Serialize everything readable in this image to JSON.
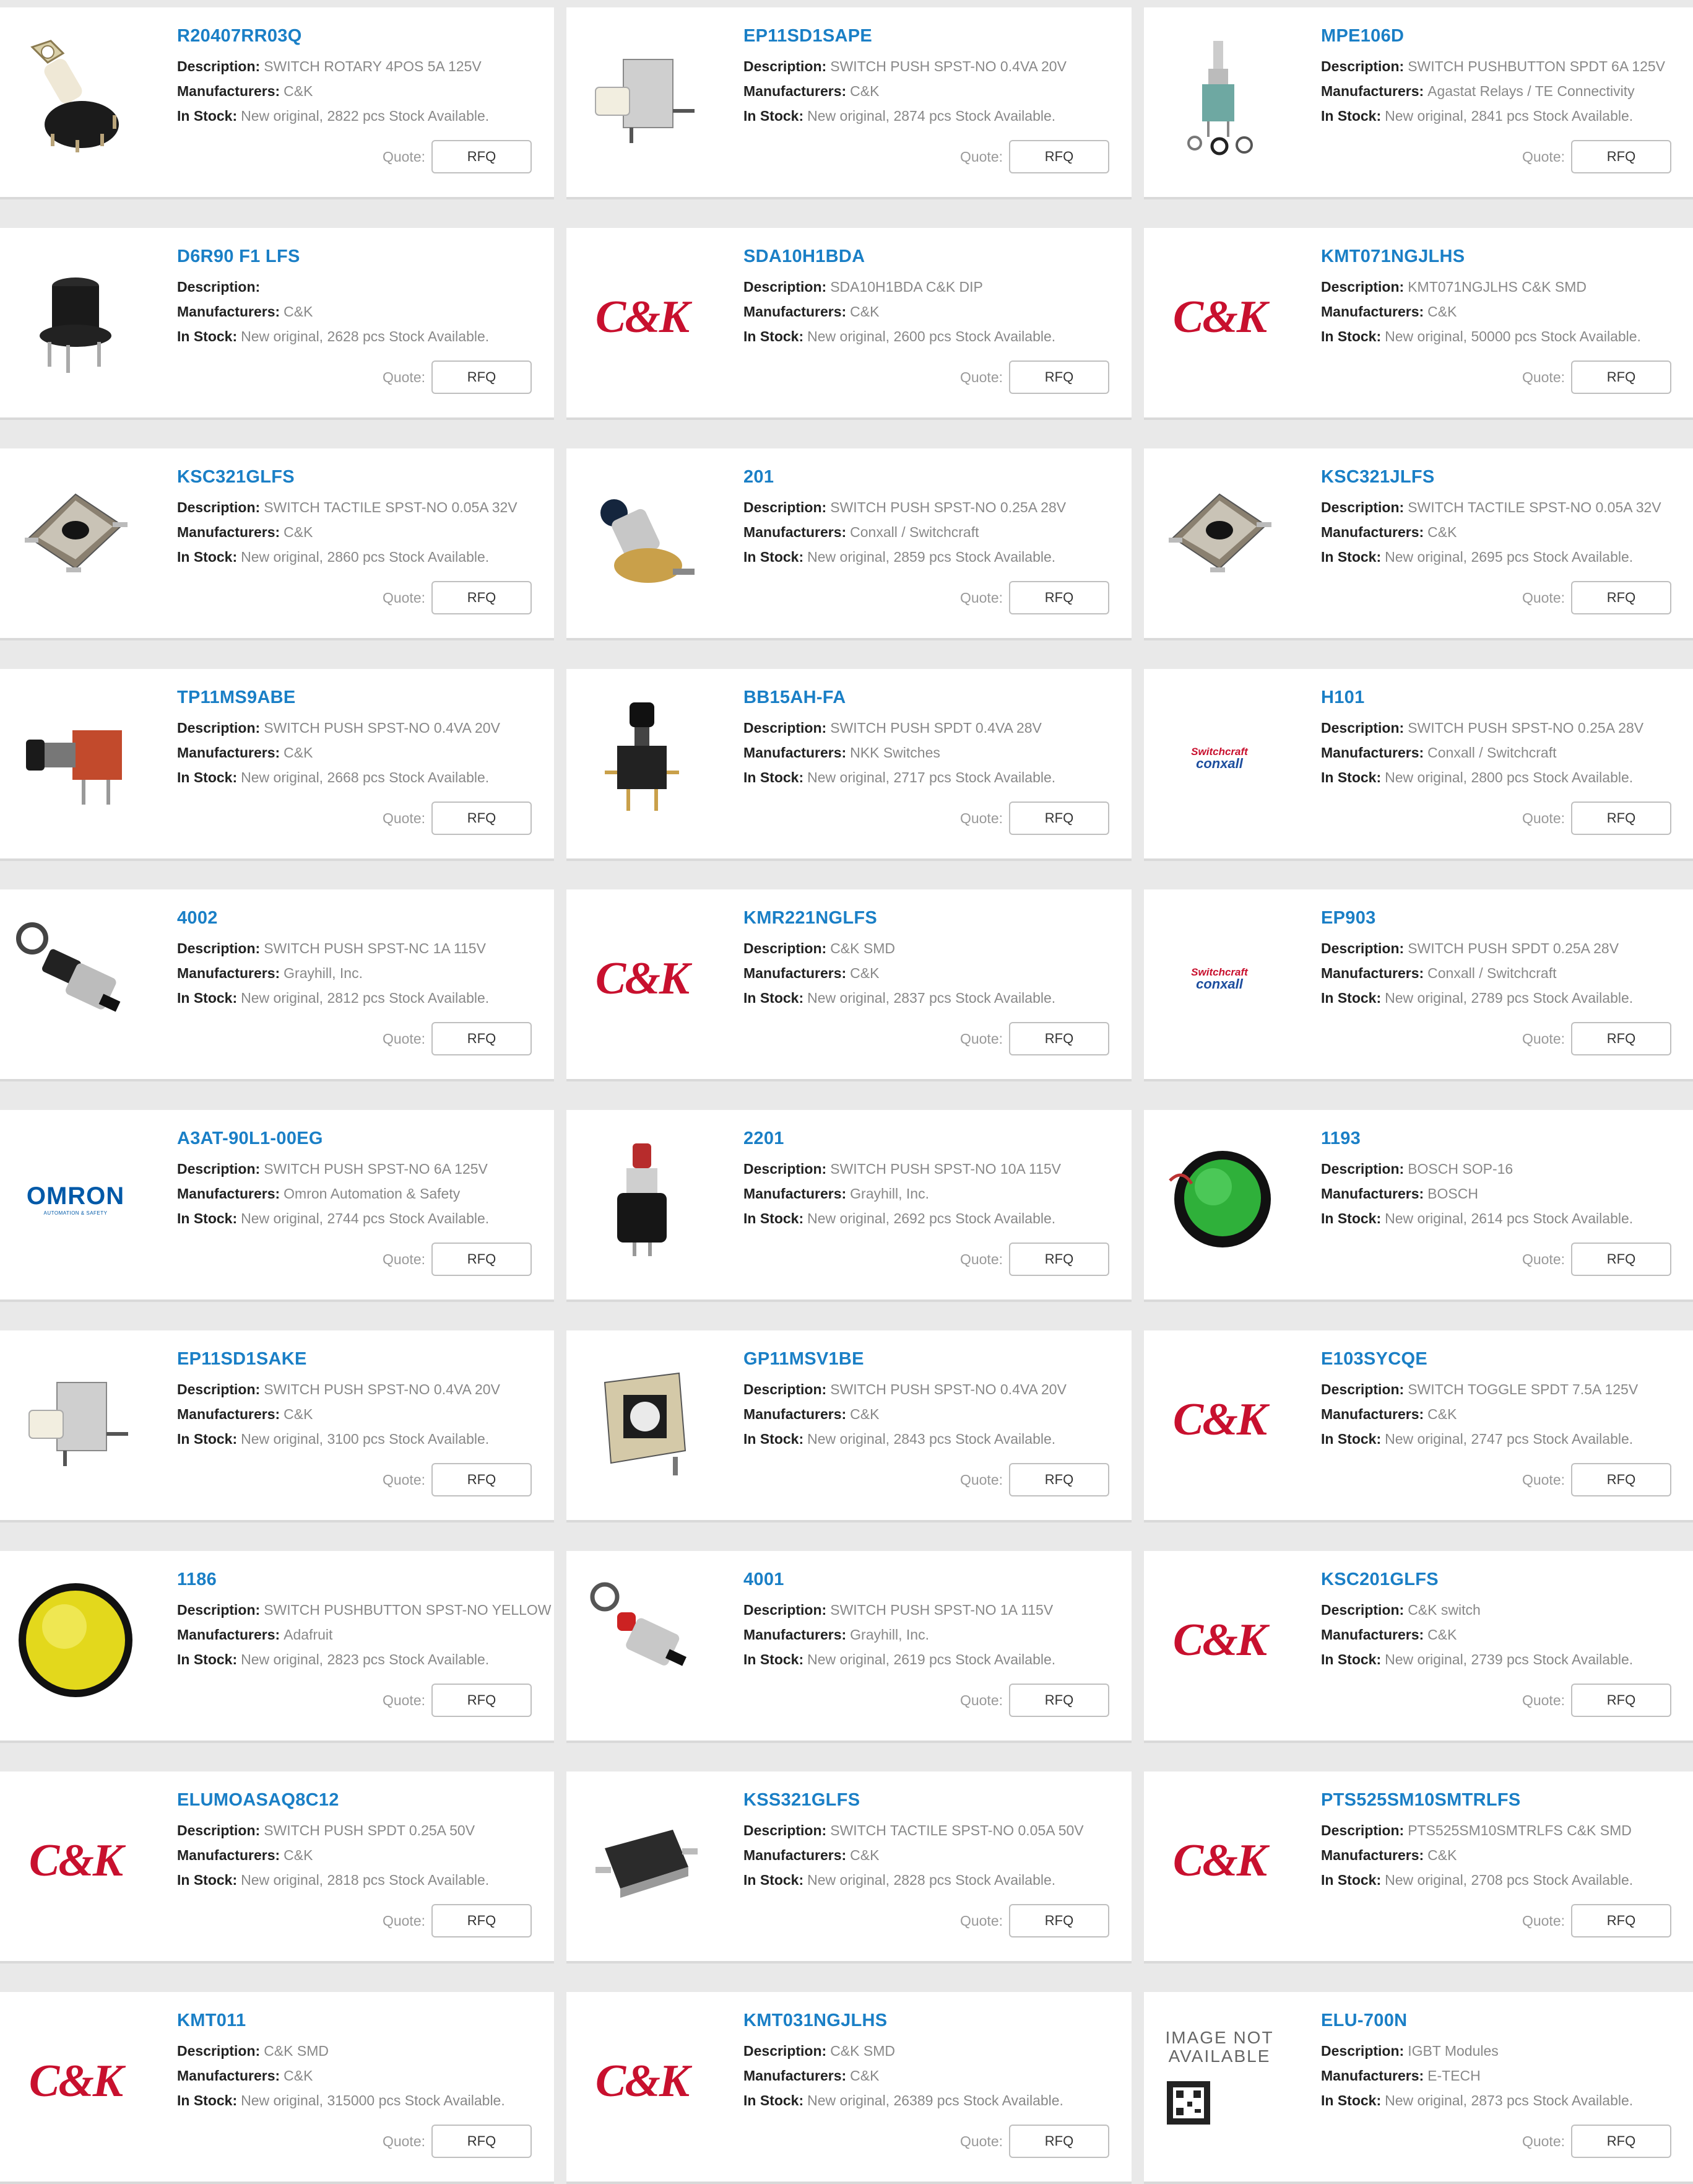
{
  "labels": {
    "description": "Description:",
    "manufacturers": "Manufacturers:",
    "in_stock": "In Stock:",
    "quote": "Quote:",
    "rfq": "RFQ"
  },
  "brands": {
    "ck": "C&K",
    "omron_word": "OMRON",
    "omron_sub": "AUTOMATION & SAFETY",
    "switchcraft": "Switchcraft",
    "conxall": "conxall",
    "image_not_available": "IMAGE NOT AVAILABLE"
  },
  "products": [
    {
      "pn": "R20407RR03Q",
      "desc": "SWITCH ROTARY 4POS 5A 125V",
      "mfr": "C&K",
      "stock": "New original, 2822 pcs Stock Available.",
      "img": "rotary-switch-image"
    },
    {
      "pn": "EP11SD1SAPE",
      "desc": "SWITCH PUSH SPST-NO 0.4VA 20V",
      "mfr": "C&K",
      "stock": "New original, 2874 pcs Stock Available.",
      "img": "push-switch-image"
    },
    {
      "pn": "MPE106D",
      "desc": "SWITCH PUSHBUTTON SPDT 6A 125V",
      "mfr": "Agastat Relays / TE Connectivity",
      "stock": "New original, 2841 pcs Stock Available.",
      "img": "pushbutton-switch-image"
    },
    {
      "pn": "D6R90 F1 LFS",
      "desc": "",
      "mfr": "C&K",
      "stock": "New original, 2628 pcs Stock Available.",
      "img": "black-round-switch-image"
    },
    {
      "pn": "SDA10H1BDA",
      "desc": "SDA10H1BDA C&K DIP",
      "mfr": "C&K",
      "stock": "New original, 2600 pcs Stock Available.",
      "img": "ck-logo"
    },
    {
      "pn": "KMT071NGJLHS",
      "desc": "KMT071NGJLHS C&K SMD",
      "mfr": "C&K",
      "stock": "New original, 50000 pcs Stock Available.",
      "img": "ck-logo"
    },
    {
      "pn": "KSC321GLFS",
      "desc": "SWITCH TACTILE SPST-NO 0.05A 32V",
      "mfr": "C&K",
      "stock": "New original, 2860 pcs Stock Available.",
      "img": "tactile-switch-image"
    },
    {
      "pn": "201",
      "desc": "SWITCH PUSH SPST-NO 0.25A 28V",
      "mfr": "Conxall / Switchcraft",
      "stock": "New original, 2859 pcs Stock Available.",
      "img": "panel-push-switch-image"
    },
    {
      "pn": "KSC321JLFS",
      "desc": "SWITCH TACTILE SPST-NO 0.05A 32V",
      "mfr": "C&K",
      "stock": "New original, 2695 pcs Stock Available.",
      "img": "tactile-switch-image"
    },
    {
      "pn": "TP11MS9ABE",
      "desc": "SWITCH PUSH SPST-NO 0.4VA 20V",
      "mfr": "C&K",
      "stock": "New original, 2668 pcs Stock Available.",
      "img": "red-push-switch-image"
    },
    {
      "pn": "BB15AH-FA",
      "desc": "SWITCH PUSH SPDT 0.4VA 28V",
      "mfr": "NKK Switches",
      "stock": "New original, 2717 pcs Stock Available.",
      "img": "pcb-push-switch-image"
    },
    {
      "pn": "H101",
      "desc": "SWITCH PUSH SPST-NO 0.25A 28V",
      "mfr": "Conxall / Switchcraft",
      "stock": "New original, 2800 pcs Stock Available.",
      "img": "switchcraft-logo"
    },
    {
      "pn": "4002",
      "desc": "SWITCH PUSH SPST-NC 1A 115V",
      "mfr": "Grayhill, Inc.",
      "stock": "New original, 2812 pcs Stock Available.",
      "img": "panel-mount-switch-image"
    },
    {
      "pn": "KMR221NGLFS",
      "desc": "C&K SMD",
      "mfr": "C&K",
      "stock": "New original, 2837 pcs Stock Available.",
      "img": "ck-logo"
    },
    {
      "pn": "EP903",
      "desc": "SWITCH PUSH SPDT 0.25A 28V",
      "mfr": "Conxall / Switchcraft",
      "stock": "New original, 2789 pcs Stock Available.",
      "img": "switchcraft-logo"
    },
    {
      "pn": "A3AT-90L1-00EG",
      "desc": "SWITCH PUSH SPST-NO 6A 125V",
      "mfr": "Omron Automation & Safety",
      "stock": "New original, 2744 pcs Stock Available.",
      "img": "omron-logo"
    },
    {
      "pn": "2201",
      "desc": "SWITCH PUSH SPST-NO 10A 115V",
      "mfr": "Grayhill, Inc.",
      "stock": "New original, 2692 pcs Stock Available.",
      "img": "red-cap-switch-image"
    },
    {
      "pn": "1193",
      "desc": "BOSCH SOP-16",
      "mfr": "BOSCH",
      "stock": "New original, 2614 pcs Stock Available.",
      "img": "green-button-image"
    },
    {
      "pn": "EP11SD1SAKE",
      "desc": "SWITCH PUSH SPST-NO 0.4VA 20V",
      "mfr": "C&K",
      "stock": "New original, 3100 pcs Stock Available.",
      "img": "push-switch-image"
    },
    {
      "pn": "GP11MSV1BE",
      "desc": "SWITCH PUSH SPST-NO 0.4VA 20V",
      "mfr": "C&K",
      "stock": "New original, 2843 pcs Stock Available.",
      "img": "square-push-switch-image"
    },
    {
      "pn": "E103SYCQE",
      "desc": "SWITCH TOGGLE SPDT 7.5A 125V",
      "mfr": "C&K",
      "stock": "New original, 2747 pcs Stock Available.",
      "img": "ck-logo"
    },
    {
      "pn": "1186",
      "desc": "SWITCH PUSHBUTTON SPST-NO YELLOW",
      "mfr": "Adafruit",
      "stock": "New original, 2823 pcs Stock Available.",
      "img": "yellow-button-image"
    },
    {
      "pn": "4001",
      "desc": "SWITCH PUSH SPST-NO 1A 115V",
      "mfr": "Grayhill, Inc.",
      "stock": "New original, 2619 pcs Stock Available.",
      "img": "red-panel-switch-image"
    },
    {
      "pn": "KSC201GLFS",
      "desc": "C&K switch",
      "mfr": "C&K",
      "stock": "New original, 2739 pcs Stock Available.",
      "img": "ck-logo"
    },
    {
      "pn": "ELUMOASAQ8C12",
      "desc": "SWITCH PUSH SPDT 0.25A 50V",
      "mfr": "C&K",
      "stock": "New original, 2818 pcs Stock Available.",
      "img": "ck-logo"
    },
    {
      "pn": "KSS321GLFS",
      "desc": "SWITCH TACTILE SPST-NO 0.05A 50V",
      "mfr": "C&K",
      "stock": "New original, 2828 pcs Stock Available.",
      "img": "smd-tactile-switch-image"
    },
    {
      "pn": "PTS525SM10SMTRLFS",
      "desc": "PTS525SM10SMTRLFS C&K SMD",
      "mfr": "C&K",
      "stock": "New original, 2708 pcs Stock Available.",
      "img": "ck-logo"
    },
    {
      "pn": "KMT011",
      "desc": "C&K SMD",
      "mfr": "C&K",
      "stock": "New original, 315000 pcs Stock Available.",
      "img": "ck-logo"
    },
    {
      "pn": "KMT031NGJLHS",
      "desc": "C&K SMD",
      "mfr": "C&K",
      "stock": "New original, 26389 pcs Stock Available.",
      "img": "ck-logo"
    },
    {
      "pn": "ELU-700N",
      "desc": "IGBT Modules",
      "mfr": "E-TECH",
      "stock": "New original, 2873 pcs Stock Available.",
      "img": "image-not-available"
    }
  ]
}
